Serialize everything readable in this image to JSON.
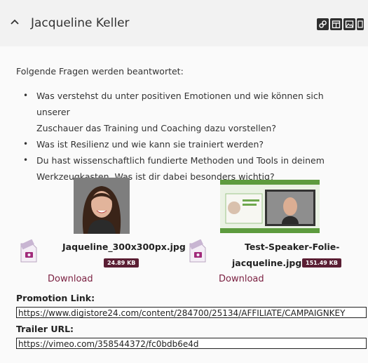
{
  "header": {
    "title": "Jacqueline Keller"
  },
  "intro": "Folgende Fragen werden beantwortet:",
  "questions": [
    "Was verstehst du unter positiven Emotionen und wie können sich unserer",
    "Zuschauer das Training und Coaching dazu vorstellen?",
    "Was ist Resilienz und wie kann sie trainiert werden?",
    "Du hast wissenschaftlich fundierte Methoden und Tools in deinem",
    "Werkzeugkasten. Was ist dir dabei besonders wichtig?"
  ],
  "files": [
    {
      "name": "Jaqueline_300x300px.jpg",
      "size": "24.89 KB",
      "download": "Download"
    },
    {
      "name_line1": "Test-Speaker-Folie-",
      "name_line2": "jacqueline.jpg",
      "size": "151.49 KB",
      "download": "Download"
    }
  ],
  "promotion": {
    "label": "Promotion Link:",
    "value": "https://www.digistore24.com/content/284700/25134/AFFILIATE/CAMPAIGNKEY"
  },
  "trailer": {
    "label": "Trailer URL:",
    "value": "https://vimeo.com/358544372/fc0bdb6e4d"
  },
  "icons": [
    "chevron-up-icon",
    "link-icon",
    "calendar-icon",
    "image-icon",
    "grid-icon",
    "file-image-icon"
  ]
}
